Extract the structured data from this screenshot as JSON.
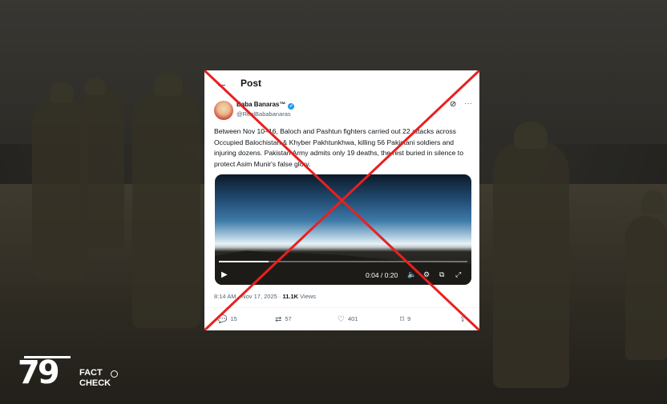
{
  "post": {
    "header_title": "Post",
    "back_icon": "back-arrow-icon",
    "author_name": "Baba Banaras™",
    "author_handle": "@RealBababanaras",
    "body": "Between Nov 10–16, Baloch and Pashtun fighters carried out 22 attacks across Occupied Balochistan & Khyber Pakhtunkhwa, killing 56 Pakistani soldiers and injuring dozens. Pakistan Army admits only 19 deaths, the rest buried in silence to protect Asim Munir's false glory.",
    "video": {
      "time": "0:04 / 0:20",
      "progress": 0.2
    },
    "timestamp": "8:14 AM · Nov 17, 2025 · ",
    "views_count": "11.1K",
    "views_label": " Views",
    "actions": {
      "replies": "15",
      "reposts": "57",
      "likes": "401",
      "bookmarks": "9"
    }
  },
  "overlay": {
    "mark": "red-x",
    "color": "#e8201f"
  },
  "logo": {
    "number": "79",
    "line1": "FACT",
    "line2": "CHECK"
  }
}
